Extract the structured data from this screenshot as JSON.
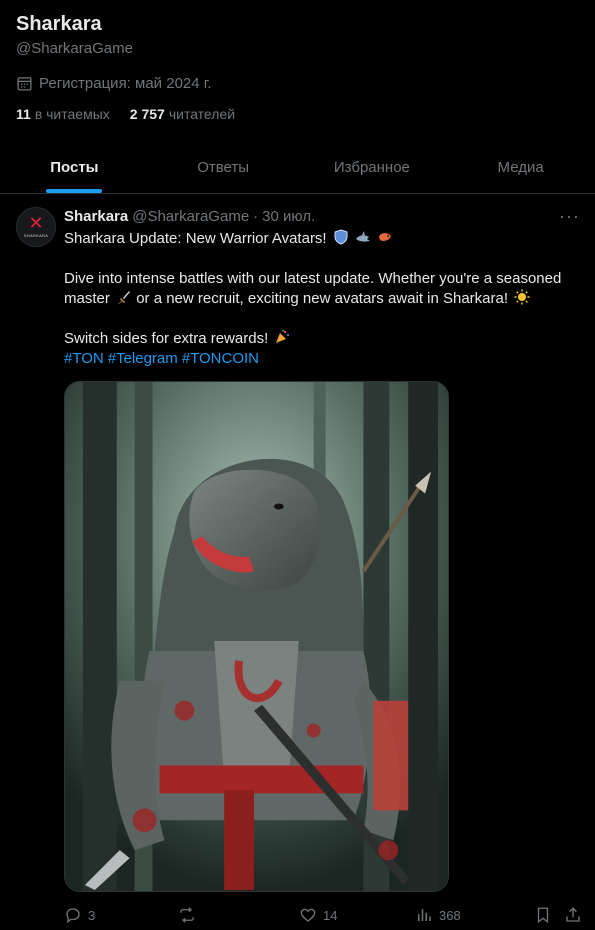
{
  "profile": {
    "name": "Sharkara",
    "handle": "@SharkaraGame",
    "joined": "Регистрация: май 2024 г.",
    "following_count": "11",
    "following_label": "в читаемых",
    "followers_count": "2 757",
    "followers_label": "читателей"
  },
  "tabs": [
    {
      "label": "Посты",
      "active": true
    },
    {
      "label": "Ответы",
      "active": false
    },
    {
      "label": "Избранное",
      "active": false
    },
    {
      "label": "Медиа",
      "active": false
    }
  ],
  "post": {
    "author": "Sharkara",
    "handle": "@SharkaraGame",
    "separator": "·",
    "date": "30 июл.",
    "more": "···",
    "avatar_text": "SHARKARA",
    "line1": "Sharkara Update: New Warrior Avatars!",
    "line2": "Dive into intense battles with our latest update. Whether you're a seasoned master",
    "line2b": "or a new recruit, exciting new avatars await in Sharkara!",
    "line3": "Switch sides for extra rewards!",
    "hashtags": [
      "#TON",
      "#Telegram",
      "#TONCOIN"
    ],
    "stats": {
      "replies": "3",
      "reposts": "",
      "likes": "14",
      "views": "368"
    }
  },
  "colors": {
    "background": "#000000",
    "accent": "#1d9bf0",
    "text": "#e7e9ea",
    "muted": "#71767b",
    "divider": "#2f3336"
  }
}
